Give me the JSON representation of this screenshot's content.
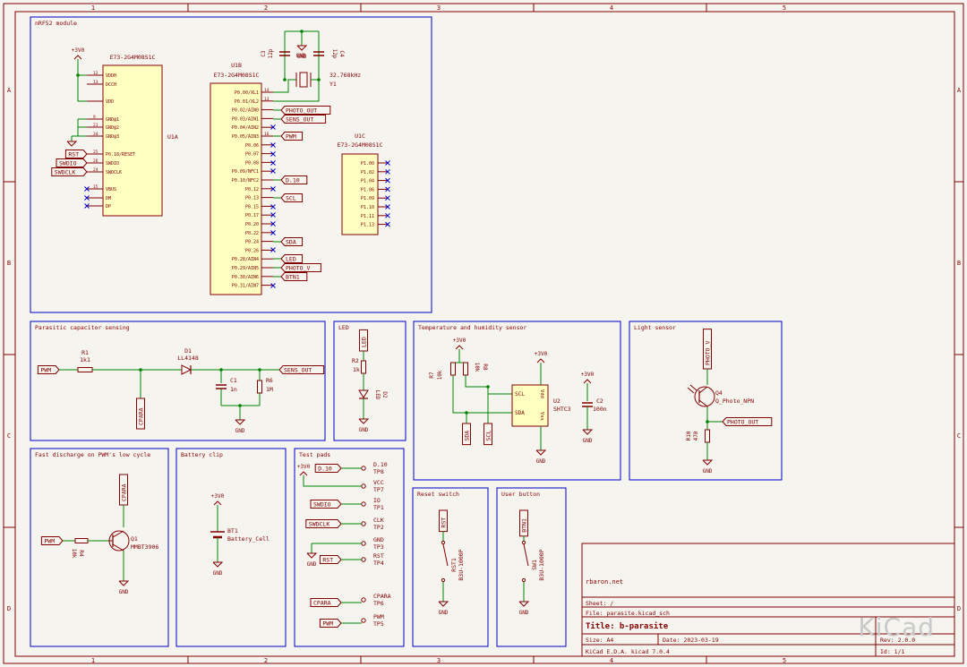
{
  "frame": {
    "cols": [
      "1",
      "2",
      "3",
      "4",
      "5"
    ],
    "rows": [
      "A",
      "B",
      "C",
      "D"
    ]
  },
  "nrf": {
    "title": "nRF52 module",
    "u1a": {
      "part": "E73-2G4M08S1C",
      "ref": "U1A",
      "pins": [
        {
          "n": "12",
          "l": "VDDH"
        },
        {
          "n": "13",
          "l": "DCCH"
        },
        {
          "n": "",
          "l": "VDD"
        },
        {
          "n": "9",
          "l": "GND@1"
        },
        {
          "n": "21",
          "l": "GND@2"
        },
        {
          "n": "34",
          "l": "GND@3"
        },
        {
          "n": "25",
          "l": "P0.18/RESET"
        },
        {
          "n": "26",
          "l": "SWDIO"
        },
        {
          "n": "24",
          "l": "SWDCLK"
        },
        {
          "n": "15",
          "l": "VBUS"
        },
        {
          "n": "",
          "l": "DM"
        },
        {
          "n": "",
          "l": "DP"
        }
      ]
    },
    "u1b": {
      "part": "E73-2G4M08S1C",
      "ref": "U1B",
      "pins": [
        {
          "n": "14",
          "l": "P0.00/XL1"
        },
        {
          "n": "13",
          "l": "P0.01/XL2"
        },
        {
          "n": "",
          "l": "P0.02/AIN0"
        },
        {
          "n": "",
          "l": "P0.03/AIN1"
        },
        {
          "n": "",
          "l": "P0.04/AIN2"
        },
        {
          "n": "16",
          "l": "P0.05/AIN3"
        },
        {
          "n": "",
          "l": "P0.06"
        },
        {
          "n": "",
          "l": "P0.07"
        },
        {
          "n": "",
          "l": "P0.08"
        },
        {
          "n": "",
          "l": "P0.09/NFC1"
        },
        {
          "n": "",
          "l": "P0.10/NFC2"
        },
        {
          "n": "",
          "l": "P0.12"
        },
        {
          "n": "",
          "l": "P0.13"
        },
        {
          "n": "",
          "l": "P0.15"
        },
        {
          "n": "",
          "l": "P0.17"
        },
        {
          "n": "",
          "l": "P0.20"
        },
        {
          "n": "",
          "l": "P0.22"
        },
        {
          "n": "",
          "l": "P0.24"
        },
        {
          "n": "",
          "l": "P0.26"
        },
        {
          "n": "",
          "l": "P0.28/AIN4"
        },
        {
          "n": "",
          "l": "P0.29/AIN5"
        },
        {
          "n": "",
          "l": "P0.30/AIN6"
        },
        {
          "n": "",
          "l": "P0.31/AIN7"
        }
      ]
    },
    "u1c": {
      "part": "E73-2G4M08S1C",
      "ref": "U1C",
      "pins": [
        "P1.00",
        "P1.02",
        "P1.04",
        "P1.06",
        "P1.09",
        "P1.10",
        "P1.11",
        "P1.13"
      ]
    },
    "crystal": {
      "ref": "Y1",
      "val": "32.768kHz"
    },
    "c3": {
      "ref": "C3",
      "val": "12p"
    },
    "c4": {
      "ref": "C4",
      "val": "12p"
    },
    "labels": {
      "photo_out": "PHOTO_OUT",
      "sens_out": "SENS_OUT",
      "pwm": "PWM",
      "d10": "D.10",
      "scl": "SCL",
      "sda": "SDA",
      "led": "LED",
      "photo_v": "PHOTO_V",
      "btn1": "BTN1",
      "rst": "RST",
      "swdio": "SWDIO",
      "swdclk": "SWDCLK"
    },
    "p3v0": "+3V0",
    "gnd": "GND"
  },
  "parasitic": {
    "title": "Parasitic capacitor sensing",
    "r1": {
      "ref": "R1",
      "val": "1k1"
    },
    "d1": {
      "ref": "D1",
      "val": "LL4148"
    },
    "c1": {
      "ref": "C1",
      "val": "1n"
    },
    "r6": {
      "ref": "R6",
      "val": "1M"
    },
    "pwm": "PWM",
    "cpara": "CPARA",
    "sens": "SENS_OUT",
    "gnd": "GND"
  },
  "led": {
    "title": "LED",
    "label": "LED",
    "r2": {
      "ref": "R2",
      "val": "1k"
    },
    "d2": {
      "ref": "D2",
      "val": "LED"
    },
    "gnd": "GND"
  },
  "temp": {
    "title": "Temperature and humidity sensor",
    "p3v0": "+3V0",
    "r7": {
      "ref": "R7",
      "val": "10k"
    },
    "r8": {
      "ref": "R8",
      "val": "10k"
    },
    "u2": {
      "ref": "U2",
      "val": "SHTC3"
    },
    "c2": {
      "ref": "C2",
      "val": "100n"
    },
    "pins": {
      "scl": "SCL",
      "sda": "SDA",
      "vdd": "Vdd",
      "vss": "Vss"
    },
    "sda": "SDA",
    "scl": "SCL",
    "gnd": "GND"
  },
  "light": {
    "title": "Light sensor",
    "photo_v": "PHOTO_V",
    "q4": {
      "ref": "Q4",
      "val": "Q_Photo_NPN"
    },
    "photo_out": "PHOTO_OUT",
    "r10": {
      "ref": "R10",
      "val": "470"
    },
    "gnd": "GND"
  },
  "fast": {
    "title": "Fast discharge on PWM's low cycle",
    "cpara": "CPARA",
    "pwm": "PWM",
    "r4": {
      "ref": "R4",
      "val": "10k"
    },
    "q1": {
      "ref": "Q1",
      "val": "MMBT3906"
    },
    "gnd": "GND"
  },
  "battery": {
    "title": "Battery clip",
    "p3v0": "+3V0",
    "bt1": {
      "ref": "BT1",
      "val": "Battery_Cell"
    },
    "gnd": "GND"
  },
  "testpads": {
    "title": "Test pads",
    "items": [
      {
        "label": "D.10",
        "name": "D.10",
        "tp": "TP8"
      },
      {
        "label": "+3V0",
        "name": "VCC",
        "tp": "TP7"
      },
      {
        "label": "SWDIO",
        "name": "IO",
        "tp": "TP1"
      },
      {
        "label": "SWDCLK",
        "name": "CLK",
        "tp": "TP2"
      },
      {
        "label": "",
        "name": "GND",
        "tp": "TP3"
      },
      {
        "label": "RST",
        "name": "RST",
        "tp": "TP4"
      },
      {
        "label": "CPARA",
        "name": "CPARA",
        "tp": "TP6"
      },
      {
        "label": "PWM",
        "name": "PWM",
        "tp": "TP5"
      }
    ],
    "gnd": "GND"
  },
  "reset": {
    "title": "Reset switch",
    "rst": "RST",
    "sw": {
      "ref": "RST1",
      "val": "B3U-1000P"
    },
    "gnd": "GND"
  },
  "userbtn": {
    "title": "User button",
    "btn": "BTN1",
    "sw": {
      "ref": "SW1",
      "val": "B3U-1000P"
    },
    "gnd": "GND"
  },
  "titleblock": {
    "company": "rbaron.net",
    "sheet": "Sheet: /",
    "file": "File: parasite.kicad_sch",
    "title": "Title: b-parasite",
    "size": "Size: A4",
    "date": "Date: 2023-03-19",
    "rev": "Rev: 2.0.0",
    "tool": "KiCad E.D.A.  kicad 7.0.4",
    "id": "Id: 1/1"
  },
  "watermark": "KiCad",
  "colors": {
    "wire": "#008400",
    "box": "#0000c8",
    "part": "#840000",
    "fill": "#ffffc2",
    "frame": "#840000"
  }
}
